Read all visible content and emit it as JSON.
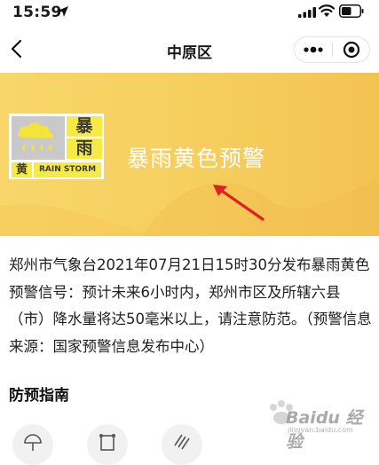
{
  "status_bar": {
    "time": "15:59",
    "location_icon": "location-arrow-icon",
    "signal_icon": "cellular-signal-icon",
    "wifi_icon": "wifi-icon",
    "battery_icon": "battery-icon"
  },
  "nav": {
    "back_icon": "chevron-left-icon",
    "title": "中原区",
    "more_icon": "more-dots-icon",
    "close_icon": "target-circle-icon"
  },
  "banner": {
    "badge_char_top": "暴",
    "badge_char_bottom": "雨",
    "badge_color_char": "黄",
    "badge_english": "RAIN STORM",
    "badge_icon": "rain-cloud-icon",
    "title": "暴雨黄色预警",
    "colors": {
      "bg": "#f6cf5e",
      "badge_yellow": "#f8ea45",
      "arrow": "#e02020"
    }
  },
  "description": "郑州市气象台2021年07月21日15时30分发布暴雨黄色预警信号：预计未来6小时内，郑州市区及所辖六县（市）降水量将达50毫米以上，请注意防范。（预警信息来源：国家预警信息发布中心）",
  "guide": {
    "title": "防预指南",
    "icons": [
      "umbrella-icon",
      "frame-icon",
      "rain-lines-icon"
    ]
  },
  "watermark": {
    "text": "Baidu 经验",
    "url": "jingyan.baidu.com"
  }
}
